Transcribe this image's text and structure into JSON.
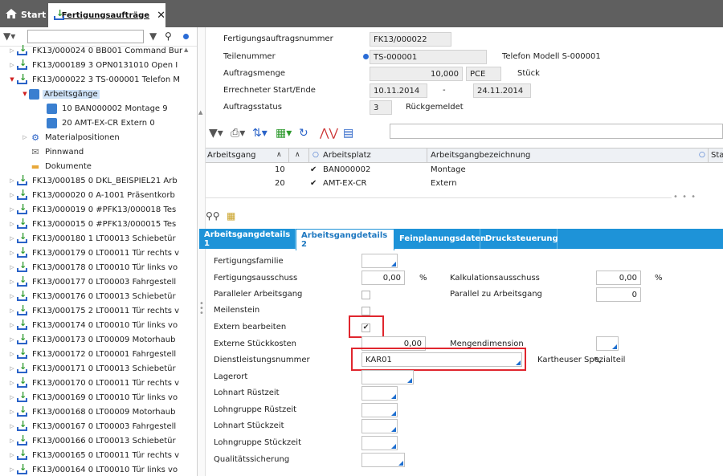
{
  "tabs": {
    "start_label": "Start",
    "main_label": "Fertigungsaufträge",
    "close_glyph": "✕"
  },
  "tree": {
    "top_partial": "FK13/000024  0  BB001  Command Bur",
    "orders": [
      {
        "id": "FK13/000189",
        "n": "3",
        "code": "OPN0131010",
        "desc": "Open I"
      },
      {
        "id": "FK13/000022",
        "n": "3",
        "code": "TS-000001",
        "desc": "Telefon M"
      }
    ],
    "arbeitsgaenge_label": "Arbeitsgänge",
    "ops": [
      {
        "num": "10",
        "code": "BAN000002",
        "desc": "Montage",
        "extra": "9"
      },
      {
        "num": "20",
        "code": "AMT-EX-CR",
        "desc": "Extern",
        "extra": "0"
      }
    ],
    "materialpositionen_label": "Materialpositionen",
    "pinnwand_label": "Pinnwand",
    "dokumente_label": "Dokumente",
    "more_orders": [
      {
        "id": "FK13/000185",
        "n": "0",
        "code": "DKL_BEISPIEL21",
        "desc": "Arb"
      },
      {
        "id": "FK13/000020",
        "n": "0",
        "code": "A-1001",
        "desc": "Präsentkorb"
      },
      {
        "id": "FK13/000019",
        "n": "0",
        "code": "#PFK13/000018",
        "desc": "Tes"
      },
      {
        "id": "FK13/000015",
        "n": "0",
        "code": "#PFK13/000015",
        "desc": "Tes"
      },
      {
        "id": "FK13/000180",
        "n": "1",
        "code": "LT00013",
        "desc": "Schiebetür"
      },
      {
        "id": "FK13/000179",
        "n": "0",
        "code": "LT00011",
        "desc": "Tür rechts v"
      },
      {
        "id": "FK13/000178",
        "n": "0",
        "code": "LT00010",
        "desc": "Tür links vo"
      },
      {
        "id": "FK13/000177",
        "n": "0",
        "code": "LT00003",
        "desc": "Fahrgestell"
      },
      {
        "id": "FK13/000176",
        "n": "0",
        "code": "LT00013",
        "desc": "Schiebetür"
      },
      {
        "id": "FK13/000175",
        "n": "2",
        "code": "LT00011",
        "desc": "Tür rechts v"
      },
      {
        "id": "FK13/000174",
        "n": "0",
        "code": "LT00010",
        "desc": "Tür links vo"
      },
      {
        "id": "FK13/000173",
        "n": "0",
        "code": "LT00009",
        "desc": "Motorhaub"
      },
      {
        "id": "FK13/000172",
        "n": "0",
        "code": "LT00001",
        "desc": "Fahrgestell"
      },
      {
        "id": "FK13/000171",
        "n": "0",
        "code": "LT00013",
        "desc": "Schiebetür"
      },
      {
        "id": "FK13/000170",
        "n": "0",
        "code": "LT00011",
        "desc": "Tür rechts v"
      },
      {
        "id": "FK13/000169",
        "n": "0",
        "code": "LT00010",
        "desc": "Tür links vo"
      },
      {
        "id": "FK13/000168",
        "n": "0",
        "code": "LT00009",
        "desc": "Motorhaub"
      },
      {
        "id": "FK13/000167",
        "n": "0",
        "code": "LT00003",
        "desc": "Fahrgestell"
      },
      {
        "id": "FK13/000166",
        "n": "0",
        "code": "LT00013",
        "desc": "Schiebetür"
      },
      {
        "id": "FK13/000165",
        "n": "0",
        "code": "LT00011",
        "desc": "Tür rechts v"
      },
      {
        "id": "FK13/000164",
        "n": "0",
        "code": "LT00010",
        "desc": "Tür links vo"
      }
    ]
  },
  "header": {
    "auftragsnummer_label": "Fertigungsauftragsnummer",
    "auftragsnummer_value": "FK13/000022",
    "teilenummer_label": "Teilenummer",
    "teilenummer_value": "TS-000001",
    "teil_desc": "Telefon Modell S-000001",
    "menge_label": "Auftragsmenge",
    "menge_value": "10,000",
    "menge_unit": "PCE",
    "menge_unit_text": "Stück",
    "start_end_label": "Errechneter Start/Ende",
    "start_value": "10.11.2014",
    "date_sep": "-",
    "end_value": "24.11.2014",
    "status_label": "Auftragsstatus",
    "status_value": "3",
    "status_text": "Rückgemeldet"
  },
  "grid": {
    "columns": {
      "arbeitsgang": "Arbeitsgang",
      "arbeitsplatz": "Arbeitsplatz",
      "bezeichnung": "Arbeitsgangbezeichnung",
      "more": "Sta"
    },
    "rows": [
      {
        "arbeitsgang": "10",
        "check": "✔",
        "arbeitsplatz": "BAN000002",
        "bezeichnung": "Montage"
      },
      {
        "arbeitsgang": "20",
        "check": "✔",
        "arbeitsplatz": "AMT-EX-CR",
        "bezeichnung": "Extern"
      }
    ],
    "more_glyph": "• • •"
  },
  "detail_tabs": [
    {
      "label": "Arbeitsgangdetails 1"
    },
    {
      "label": "Arbeitsgangdetails 2"
    },
    {
      "label": "Feinplanungsdaten"
    },
    {
      "label": "Drucksteuerung"
    }
  ],
  "detail": {
    "fertigungsfamilie": "Fertigungsfamilie",
    "fertigungsausschuss": "Fertigungsausschuss",
    "fertigungsausschuss_value": "0,00",
    "percent": "%",
    "kalkulationsausschuss": "Kalkulationsausschuss",
    "kalkulationsausschuss_value": "0,00",
    "paralleler": "Paralleler Arbeitsgang",
    "parallel_zu": "Parallel zu Arbeitsgang",
    "parallel_zu_value": "0",
    "meilenstein": "Meilenstein",
    "extern": "Extern bearbeiten",
    "extern_check": "✔",
    "externe_kosten": "Externe Stückkosten",
    "externe_kosten_value": "0,00",
    "mengendimension": "Mengendimension",
    "dienstleistung": "Dienstleistungsnummer",
    "dienstleistung_value": "KAR01",
    "dienstleistung_desc": "Kartheuser Spezialteil",
    "lagerort": "Lagerort",
    "lohnart_ruest": "Lohnart Rüstzeit",
    "lohngruppe_ruest": "Lohngruppe Rüstzeit",
    "lohnart_stueck": "Lohnart Stückzeit",
    "lohngruppe_stueck": "Lohngruppe Stückzeit",
    "qualitaet": "Qualitätssicherung"
  },
  "colors": {
    "topbar": "#5f5f5f",
    "tab_accent": "#1e93d8",
    "highlight": "#e0262e",
    "selection": "#cfe3f8"
  }
}
